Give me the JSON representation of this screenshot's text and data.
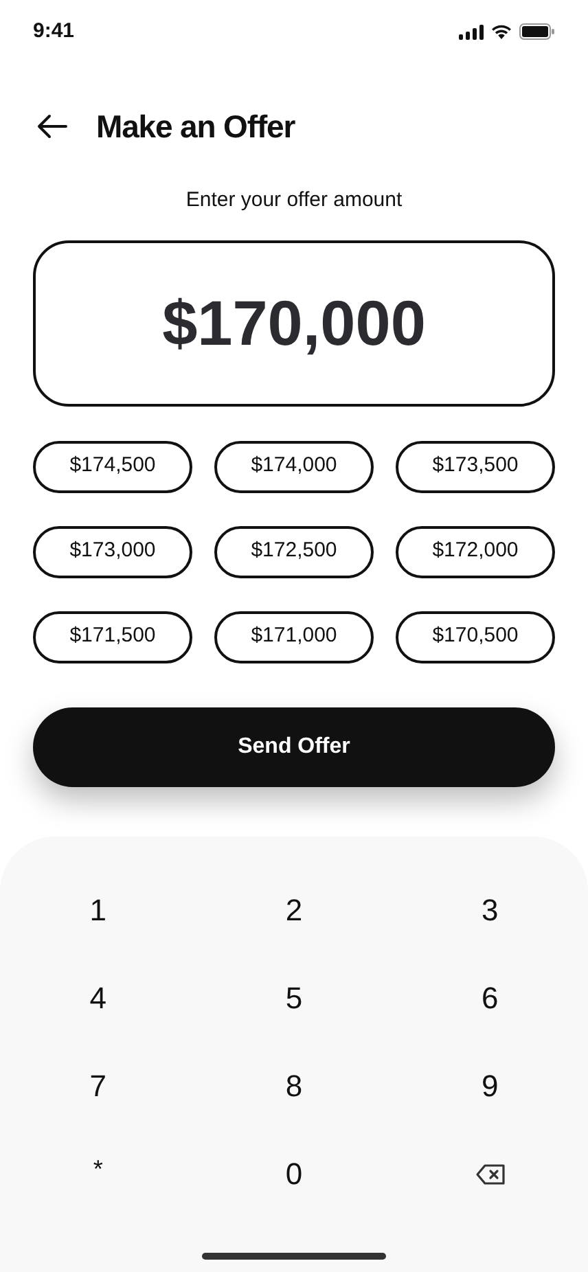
{
  "status_bar": {
    "time": "9:41"
  },
  "header": {
    "title": "Make an Offer"
  },
  "prompt": "Enter your offer amount",
  "amount": "$170,000",
  "suggestions": [
    "$174,500",
    "$174,000",
    "$173,500",
    "$173,000",
    "$172,500",
    "$172,000",
    "$171,500",
    "$171,000",
    "$170,500"
  ],
  "send_button": "Send Offer",
  "keypad": [
    {
      "kind": "digit",
      "label": "1"
    },
    {
      "kind": "digit",
      "label": "2"
    },
    {
      "kind": "digit",
      "label": "3"
    },
    {
      "kind": "digit",
      "label": "4"
    },
    {
      "kind": "digit",
      "label": "5"
    },
    {
      "kind": "digit",
      "label": "6"
    },
    {
      "kind": "digit",
      "label": "7"
    },
    {
      "kind": "digit",
      "label": "8"
    },
    {
      "kind": "digit",
      "label": "9"
    },
    {
      "kind": "symbol",
      "label": "*"
    },
    {
      "kind": "digit",
      "label": "0"
    },
    {
      "kind": "backspace"
    }
  ]
}
